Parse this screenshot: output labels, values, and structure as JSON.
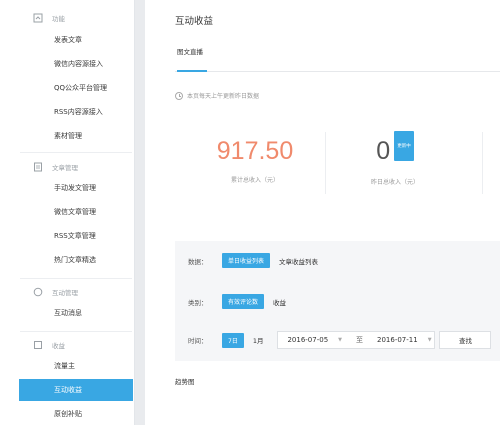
{
  "sidebar": {
    "sections": [
      {
        "title": "功能",
        "icon": "function-icon",
        "items": [
          "发表文章",
          "微信内容源接入",
          "QQ公众平台管理",
          "RSS内容源接入",
          "素材管理"
        ]
      },
      {
        "title": "文章管理",
        "icon": "document-icon",
        "items": [
          "手动发文管理",
          "微信文章管理",
          "RSS文章管理",
          "热门文章精选"
        ]
      },
      {
        "title": "互动管理",
        "icon": "circle-icon",
        "items": [
          "互动消息"
        ]
      },
      {
        "title": "收益",
        "icon": "square-icon",
        "items": [
          "流量主",
          "互动收益",
          "原创补贴"
        ]
      }
    ],
    "active_item": "互动收益"
  },
  "main": {
    "title": "互动收益",
    "tab": "图文直播",
    "notice": "本页每天上午更新昨日数据",
    "stats": [
      {
        "value": "917.50",
        "label": "累计总收入（元）",
        "color": "#f08a6c"
      },
      {
        "value": "0",
        "label": "昨日总收入（元）",
        "badge": "更新中",
        "color": "#555555"
      }
    ],
    "filters": {
      "data_label": "数据：",
      "data_options": [
        "单日收益列表",
        "文章收益列表"
      ],
      "category_label": "类别：",
      "category_options": [
        "有效评论数",
        "收益"
      ],
      "time_label": "时间：",
      "time_options": [
        "7日",
        "1月"
      ],
      "date_start": "2016-07-05",
      "date_sep": "至",
      "date_end": "2016-07-11",
      "search_label": "查找"
    },
    "trend_label": "趋势图"
  },
  "colors": {
    "accent": "#39a7e3",
    "income": "#f08a6c"
  }
}
